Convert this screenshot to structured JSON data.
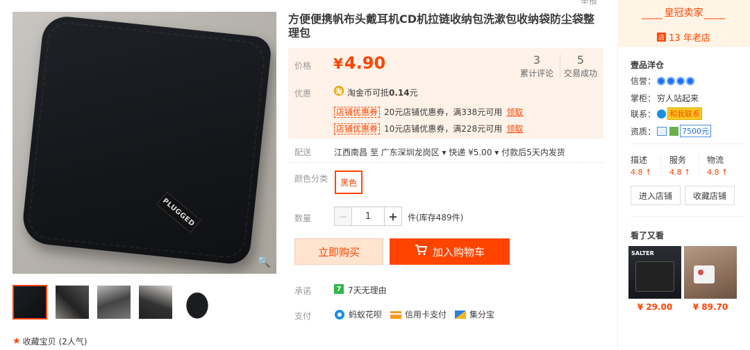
{
  "topright": "举报",
  "title": "方便便携帆布头戴耳机CD机拉链收纳包洗漱包收纳袋防尘袋整理包",
  "product_image_label": "PLUGGED",
  "favorite": {
    "text": "收藏宝贝 (2人气)"
  },
  "price": {
    "label": "价格",
    "currency": "¥",
    "value": "4.90"
  },
  "stats": [
    {
      "num": "3",
      "text": "累计评论"
    },
    {
      "num": "5",
      "text": "交易成功"
    }
  ],
  "promo": {
    "label": "优惠",
    "coin_text": "淘金币可抵",
    "coin_amount": "0.14",
    "coin_unit": "元",
    "coupons": [
      {
        "tag": "店铺优惠券",
        "desc": "20元店铺优惠券，满338元可用",
        "get": "领取"
      },
      {
        "tag": "店铺优惠券",
        "desc": "10元店铺优惠券，满228元可用",
        "get": "领取"
      }
    ]
  },
  "shipping": {
    "label": "配送",
    "text": "江西南昌 至  广东深圳龙岗区 ▾  快递 ¥5.00 ▾  付款后5天内发货"
  },
  "color": {
    "label": "颜色分类",
    "option": "黑色"
  },
  "quantity": {
    "label": "数量",
    "value": "1",
    "minus": "−",
    "plus": "+",
    "stock": "件(库存489件)"
  },
  "buttons": {
    "buy_now": "立即购买",
    "add_cart": "加入购物车"
  },
  "promise": {
    "label": "承诺",
    "icon": "7",
    "text": "7天无理由"
  },
  "payment": {
    "label": "支付",
    "methods": [
      "蚂蚁花呗",
      "信用卡支付",
      "集分宝"
    ]
  },
  "seller": {
    "crown": "皇冠卖家",
    "years": "13 年老店",
    "shop_icon": "店",
    "shop_name": "壹品洋仓",
    "credit_label": "信誉：",
    "keeper_label": "掌柜：",
    "keeper_value": "穷人站起来",
    "contact_label": "联系：",
    "contact_value": "和我联系",
    "qual_label": "资质：",
    "qual_value": "7500元",
    "scores": [
      {
        "title": "描述",
        "value": "4.8 ↑"
      },
      {
        "title": "服务",
        "value": "4.8 ↑"
      },
      {
        "title": "物流",
        "value": "4.8 ↑"
      }
    ],
    "enter_shop": "进入店铺",
    "fav_shop": "收藏店铺"
  },
  "see_also": {
    "title": "看了又看",
    "items": [
      {
        "price": "¥ 29.00",
        "label": "SALTER"
      },
      {
        "price": "¥ 89.70"
      }
    ]
  },
  "colors": {
    "accent": "#ff4400",
    "price_bg": "#fff2e8"
  }
}
